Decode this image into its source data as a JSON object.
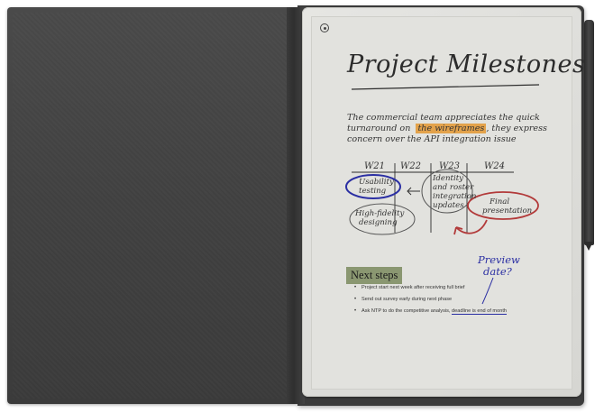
{
  "note": {
    "title": "Project Milestones",
    "paragraph_lines": [
      "The commercial team appreciates the quick",
      "turnaround on",
      "the wireframes",
      ", they express",
      "concern over the API integration issue"
    ],
    "timeline": {
      "weeks": [
        "W21",
        "W22",
        "W23",
        "W24"
      ],
      "bubbles": {
        "usability": [
          "Usability",
          "testing"
        ],
        "hifi": [
          "High-fidelity",
          "designing"
        ],
        "identity": [
          "Identity",
          "and roster",
          "integration",
          "updates"
        ],
        "final": [
          "Final",
          "presentation"
        ]
      }
    },
    "annotation": [
      "Preview",
      "date?"
    ],
    "section_heading": "Next steps",
    "bullets": [
      "Project start next week after receiving full brief",
      "Send out survey early during next phase",
      "Ask NTP to do the competitive analysis,",
      "deadline is end of month"
    ]
  },
  "colors": {
    "highlight": "#e3a24b",
    "heading_bg": "#8a9771",
    "ink_blue": "#2b2fa3",
    "ink_red": "#b23a3a",
    "ink_dark": "#2c2c2c",
    "folio": "#444444"
  },
  "icons": [
    "toolbar-menu-icon",
    "marker-pen-icon"
  ]
}
